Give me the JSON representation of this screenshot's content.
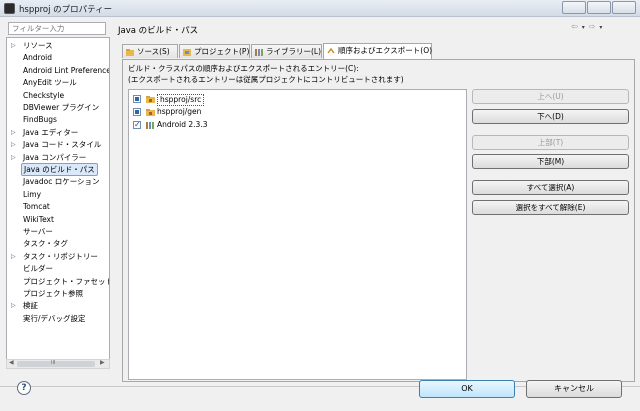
{
  "window": {
    "title": "hspproj のプロパティー"
  },
  "filter": {
    "placeholder": "フィルター入力"
  },
  "nav": {
    "items": [
      {
        "label": "リソース",
        "expandable": true
      },
      {
        "label": "Android",
        "expandable": false
      },
      {
        "label": "Android Lint Preferences",
        "expandable": false
      },
      {
        "label": "AnyEdit ツール",
        "expandable": false
      },
      {
        "label": "Checkstyle",
        "expandable": false
      },
      {
        "label": "DBViewer プラグイン",
        "expandable": false
      },
      {
        "label": "FindBugs",
        "expandable": false
      },
      {
        "label": "Java エディター",
        "expandable": true
      },
      {
        "label": "Java コード・スタイル",
        "expandable": true
      },
      {
        "label": "Java コンパイラー",
        "expandable": true
      },
      {
        "label": "Java のビルド・パス",
        "expandable": false,
        "selected": true
      },
      {
        "label": "Javadoc ロケーション",
        "expandable": false
      },
      {
        "label": "Limy",
        "expandable": false
      },
      {
        "label": "Tomcat",
        "expandable": false
      },
      {
        "label": "WikiText",
        "expandable": false
      },
      {
        "label": "サーバー",
        "expandable": false
      },
      {
        "label": "タスク・タグ",
        "expandable": false
      },
      {
        "label": "タスク・リポジトリー",
        "expandable": true
      },
      {
        "label": "ビルダー",
        "expandable": false
      },
      {
        "label": "プロジェクト・ファセット",
        "expandable": false
      },
      {
        "label": "プロジェクト参照",
        "expandable": false
      },
      {
        "label": "検証",
        "expandable": true
      },
      {
        "label": "実行/デバッグ設定",
        "expandable": false
      }
    ],
    "scrollbar_middle": "III"
  },
  "page": {
    "title": "Java のビルド・パス",
    "nav_back": "⇦",
    "nav_forward": "⇨",
    "nav_dropdown": "▾"
  },
  "tabs": [
    {
      "label": "ソース(S)"
    },
    {
      "label": "プロジェクト(P)"
    },
    {
      "label": "ライブラリー(L)"
    },
    {
      "label": "順序およびエクスポート(O)",
      "active": true
    }
  ],
  "order": {
    "description_line1": "ビルド・クラスパスの順序およびエクスポートされるエントリー(C):",
    "description_line2": "(エクスポートされるエントリーは従属プロジェクトにコントリビュートされます)",
    "entries": [
      {
        "label": "hspproj/src",
        "checked": "filled",
        "icon": "source-folder-icon"
      },
      {
        "label": "hspproj/gen",
        "checked": "filled",
        "icon": "source-folder-icon"
      },
      {
        "label": "Android 2.3.3",
        "checked": "checked",
        "icon": "library-icon"
      }
    ]
  },
  "buttons": {
    "top": "上へ(U)",
    "up": "下へ(D)",
    "top_most": "上部(T)",
    "bottom": "下部(M)",
    "select_all": "すべて選択(A)",
    "deselect_all": "選択をすべて解除(E)"
  },
  "footer": {
    "help": "?",
    "ok": "OK",
    "cancel": "キャンセル"
  },
  "colors": {
    "accent": "#3c7fb1",
    "selection": "#d9e9f9"
  }
}
